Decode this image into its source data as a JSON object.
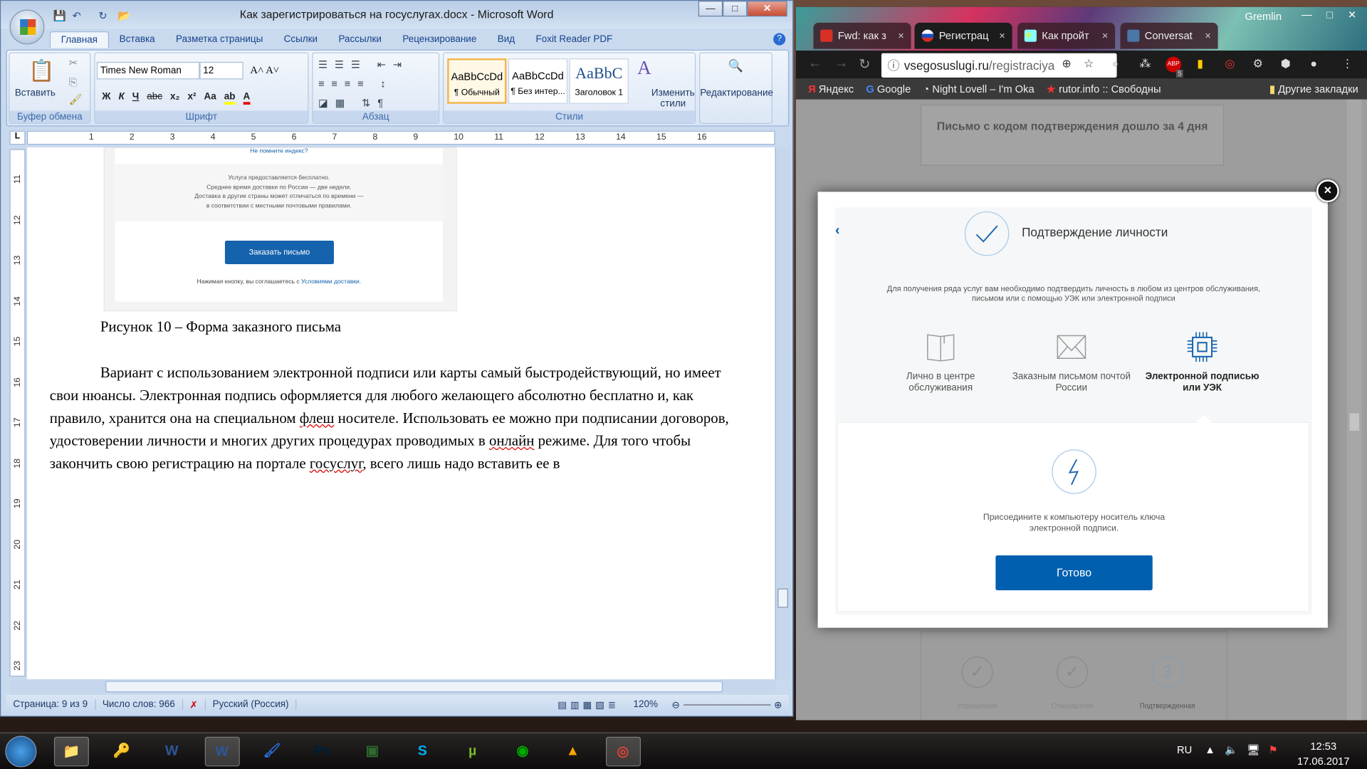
{
  "word": {
    "title": "Как зарегистрироваться на госуслугах.docx - Microsoft Word",
    "tabs": [
      "Главная",
      "Вставка",
      "Разметка страницы",
      "Ссылки",
      "Рассылки",
      "Рецензирование",
      "Вид",
      "Foxit Reader PDF"
    ],
    "groups": {
      "clipboard": "Буфер обмена",
      "font": "Шрифт",
      "paragraph": "Абзац",
      "styles": "Стили"
    },
    "paste": "Вставить",
    "font_name": "Times New Roman",
    "font_size": "12",
    "format_buttons": [
      "Ж",
      "К",
      "Ч",
      "abc",
      "x₂",
      "x²",
      "Aa"
    ],
    "styles": [
      {
        "sample": "AaBbCcDd",
        "name": "¶ Обычный"
      },
      {
        "sample": "AaBbCcDd",
        "name": "¶ Без интер..."
      },
      {
        "sample": "AaBbC",
        "name": "Заголовок 1"
      }
    ],
    "change_styles": "Изменить стили",
    "editing": "Редактирование",
    "ruler": [
      "1",
      "2",
      "3",
      "4",
      "5",
      "6",
      "7",
      "8",
      "9",
      "10",
      "11",
      "12",
      "13",
      "14",
      "15",
      "16"
    ],
    "vruler": [
      "11",
      "12",
      "13",
      "14",
      "15",
      "16",
      "17",
      "18",
      "19",
      "20",
      "21",
      "22",
      "23"
    ],
    "figure": {
      "top_text": "Не помните индекс?",
      "lines": [
        "Услуга предоставляется бесплатно.",
        "Среднее время доставки по России — две недели.",
        "Доставка в другие страны может отличаться по времени —",
        "в соответствии с местными  почтовыми правилами."
      ],
      "button": "Заказать письмо",
      "terms_prefix": "Нажимая кнопку, вы соглашаетесь с ",
      "terms_link": "Условиями доставки."
    },
    "caption": "Рисунок 10 – Форма заказного письма",
    "paragraph": [
      "Вариант с использованием электронной подписи или карты самый быстродействующий, но имеет свои нюансы. Электронная подпись оформляется для любого желающего абсолютно бесплатно и, как правило, хранится она на специальном ",
      "флеш",
      " носителе. Использовать ее можно при подписании договоров, удостоверении личности и многих других процедурах проводимых в ",
      "онлайн",
      " режиме. Для того чтобы закончить свою регистрацию на портале ",
      "госуслуг",
      ", всего лишь надо вставить ее в"
    ],
    "status": {
      "page": "Страница: 9 из 9",
      "words": "Число слов: 966",
      "lang": "Русский (Россия)",
      "zoom": "120%"
    }
  },
  "chrome": {
    "profile": "Gremlin",
    "tabs": [
      {
        "title": "Fwd: как з",
        "icon": "gmail-icon"
      },
      {
        "title": "Регистрац",
        "icon": "russia-flag-icon",
        "active": true
      },
      {
        "title": "Как пройт",
        "icon": "sun-icon"
      },
      {
        "title": "Conversat",
        "icon": "chat-icon"
      }
    ],
    "url_host": "vsegosuslugi.ru",
    "url_path": "/registraciya",
    "abp_count": "5",
    "bookmarks": [
      "Яндекс",
      "Google",
      "Night Lovell – I'm Oka",
      "rutor.info :: Свободны"
    ],
    "other_bookmarks": "Другие закладки",
    "page": {
      "bg_card": "Письмо с кодом подтверждения дошло за 4 дня",
      "steps": [
        {
          "label": "Упрощенная",
          "mark": "✓"
        },
        {
          "label": "Стандартная",
          "mark": "✓"
        },
        {
          "label": "Подтвержденная",
          "mark": "3"
        }
      ]
    },
    "modal": {
      "title": "Подтверждение личности",
      "description": "Для получения ряда услуг вам необходимо подтвердить личность в любом из центров обслуживания, письмом или с помощью УЭК или электронной подписи",
      "options": [
        {
          "label": "Лично в центре обслуживания",
          "icon": "book-icon"
        },
        {
          "label": "Заказным письмом почтой России",
          "icon": "envelope-icon"
        },
        {
          "label": "Электронной подписью или УЭК",
          "icon": "chip-icon",
          "selected": true
        }
      ],
      "panel_text": "Присоедините к компьютеру носитель ключа электронной подписи.",
      "done": "Готово",
      "accent": "#0060af"
    }
  },
  "taskbar": {
    "apps": [
      "explorer",
      "access",
      "word-2003",
      "word",
      "paint",
      "photoshop",
      "terminal",
      "skype",
      "utorrent",
      "emb",
      "aimp",
      "chrome"
    ],
    "lang": "RU",
    "time": "12:53",
    "date": "17.06.2017"
  }
}
